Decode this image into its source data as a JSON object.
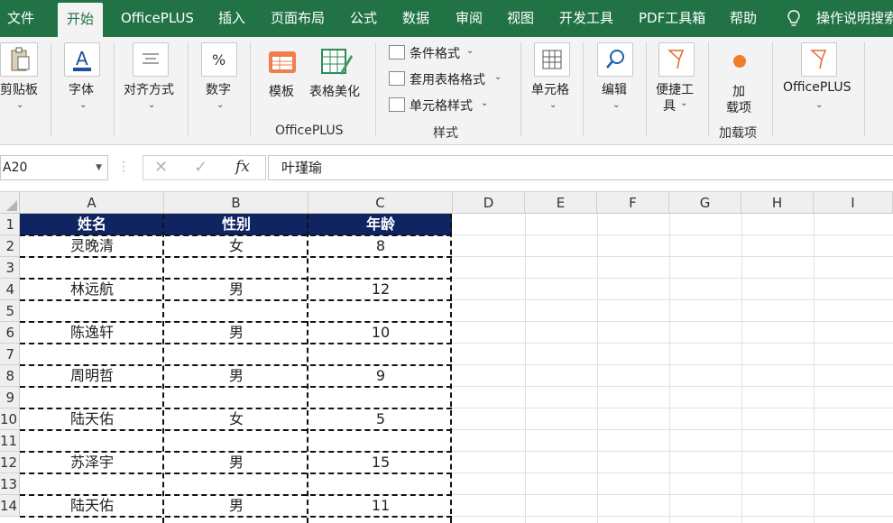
{
  "tabs": [
    "文件",
    "开始",
    "OfficePLUS",
    "插入",
    "页面布局",
    "公式",
    "数据",
    "审阅",
    "视图",
    "开发工具",
    "PDF工具箱",
    "帮助",
    "操作说明搜索"
  ],
  "ribbon": {
    "clipboard": "剪贴板",
    "font": "字体",
    "align": "对齐方式",
    "number": "数字",
    "template": "模板",
    "beautify": "表格美化",
    "officeplus_group": "OfficePLUS",
    "cond_format": "条件格式",
    "table_format": "套用表格格式",
    "cell_style": "单元格样式",
    "style_group": "样式",
    "cells": "单元格",
    "edit": "编辑",
    "quick_tools_1": "便捷工",
    "quick_tools_2": "具",
    "addin_1": "加",
    "addin_2": "载项",
    "addin_group": "加载项",
    "officeplus_btn": "OfficePLUS"
  },
  "formula_bar": {
    "name_box": "A20",
    "content": "叶瑾瑜"
  },
  "columns": [
    "A",
    "B",
    "C",
    "D",
    "E",
    "F",
    "G",
    "H",
    "I"
  ],
  "row_numbers": [
    "1",
    "2",
    "3",
    "4",
    "5",
    "6",
    "7",
    "8",
    "9",
    "10",
    "11",
    "12",
    "13",
    "14"
  ],
  "table": {
    "headers": [
      "姓名",
      "性别",
      "年龄"
    ],
    "rows": [
      {
        "row": "2",
        "name": "灵晚清",
        "gender": "女",
        "age": "8"
      },
      {
        "row": "4",
        "name": "林远航",
        "gender": "男",
        "age": "12"
      },
      {
        "row": "6",
        "name": "陈逸轩",
        "gender": "男",
        "age": "10"
      },
      {
        "row": "8",
        "name": "周明哲",
        "gender": "男",
        "age": "9"
      },
      {
        "row": "10",
        "name": "陆天佑",
        "gender": "女",
        "age": "5"
      },
      {
        "row": "12",
        "name": "苏泽宇",
        "gender": "男",
        "age": "15"
      },
      {
        "row": "14",
        "name": "陆天佑",
        "gender": "男",
        "age": "11"
      }
    ]
  },
  "colors": {
    "ribbon_green": "#217346",
    "header_fill": "#0f2461",
    "border_dash": "#111111"
  }
}
